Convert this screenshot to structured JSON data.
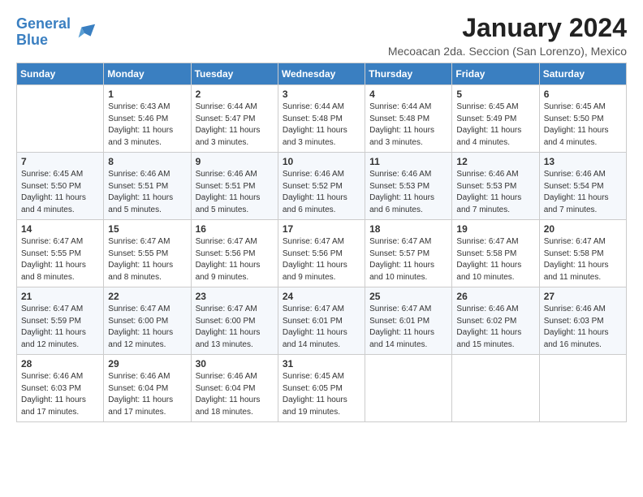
{
  "header": {
    "logo_line1": "General",
    "logo_line2": "Blue",
    "month": "January 2024",
    "location": "Mecoacan 2da. Seccion (San Lorenzo), Mexico"
  },
  "weekdays": [
    "Sunday",
    "Monday",
    "Tuesday",
    "Wednesday",
    "Thursday",
    "Friday",
    "Saturday"
  ],
  "weeks": [
    [
      {
        "day": "",
        "info": ""
      },
      {
        "day": "1",
        "info": "Sunrise: 6:43 AM\nSunset: 5:46 PM\nDaylight: 11 hours\nand 3 minutes."
      },
      {
        "day": "2",
        "info": "Sunrise: 6:44 AM\nSunset: 5:47 PM\nDaylight: 11 hours\nand 3 minutes."
      },
      {
        "day": "3",
        "info": "Sunrise: 6:44 AM\nSunset: 5:48 PM\nDaylight: 11 hours\nand 3 minutes."
      },
      {
        "day": "4",
        "info": "Sunrise: 6:44 AM\nSunset: 5:48 PM\nDaylight: 11 hours\nand 3 minutes."
      },
      {
        "day": "5",
        "info": "Sunrise: 6:45 AM\nSunset: 5:49 PM\nDaylight: 11 hours\nand 4 minutes."
      },
      {
        "day": "6",
        "info": "Sunrise: 6:45 AM\nSunset: 5:50 PM\nDaylight: 11 hours\nand 4 minutes."
      }
    ],
    [
      {
        "day": "7",
        "info": "Sunrise: 6:45 AM\nSunset: 5:50 PM\nDaylight: 11 hours\nand 4 minutes."
      },
      {
        "day": "8",
        "info": "Sunrise: 6:46 AM\nSunset: 5:51 PM\nDaylight: 11 hours\nand 5 minutes."
      },
      {
        "day": "9",
        "info": "Sunrise: 6:46 AM\nSunset: 5:51 PM\nDaylight: 11 hours\nand 5 minutes."
      },
      {
        "day": "10",
        "info": "Sunrise: 6:46 AM\nSunset: 5:52 PM\nDaylight: 11 hours\nand 6 minutes."
      },
      {
        "day": "11",
        "info": "Sunrise: 6:46 AM\nSunset: 5:53 PM\nDaylight: 11 hours\nand 6 minutes."
      },
      {
        "day": "12",
        "info": "Sunrise: 6:46 AM\nSunset: 5:53 PM\nDaylight: 11 hours\nand 7 minutes."
      },
      {
        "day": "13",
        "info": "Sunrise: 6:46 AM\nSunset: 5:54 PM\nDaylight: 11 hours\nand 7 minutes."
      }
    ],
    [
      {
        "day": "14",
        "info": "Sunrise: 6:47 AM\nSunset: 5:55 PM\nDaylight: 11 hours\nand 8 minutes."
      },
      {
        "day": "15",
        "info": "Sunrise: 6:47 AM\nSunset: 5:55 PM\nDaylight: 11 hours\nand 8 minutes."
      },
      {
        "day": "16",
        "info": "Sunrise: 6:47 AM\nSunset: 5:56 PM\nDaylight: 11 hours\nand 9 minutes."
      },
      {
        "day": "17",
        "info": "Sunrise: 6:47 AM\nSunset: 5:56 PM\nDaylight: 11 hours\nand 9 minutes."
      },
      {
        "day": "18",
        "info": "Sunrise: 6:47 AM\nSunset: 5:57 PM\nDaylight: 11 hours\nand 10 minutes."
      },
      {
        "day": "19",
        "info": "Sunrise: 6:47 AM\nSunset: 5:58 PM\nDaylight: 11 hours\nand 10 minutes."
      },
      {
        "day": "20",
        "info": "Sunrise: 6:47 AM\nSunset: 5:58 PM\nDaylight: 11 hours\nand 11 minutes."
      }
    ],
    [
      {
        "day": "21",
        "info": "Sunrise: 6:47 AM\nSunset: 5:59 PM\nDaylight: 11 hours\nand 12 minutes."
      },
      {
        "day": "22",
        "info": "Sunrise: 6:47 AM\nSunset: 6:00 PM\nDaylight: 11 hours\nand 12 minutes."
      },
      {
        "day": "23",
        "info": "Sunrise: 6:47 AM\nSunset: 6:00 PM\nDaylight: 11 hours\nand 13 minutes."
      },
      {
        "day": "24",
        "info": "Sunrise: 6:47 AM\nSunset: 6:01 PM\nDaylight: 11 hours\nand 14 minutes."
      },
      {
        "day": "25",
        "info": "Sunrise: 6:47 AM\nSunset: 6:01 PM\nDaylight: 11 hours\nand 14 minutes."
      },
      {
        "day": "26",
        "info": "Sunrise: 6:46 AM\nSunset: 6:02 PM\nDaylight: 11 hours\nand 15 minutes."
      },
      {
        "day": "27",
        "info": "Sunrise: 6:46 AM\nSunset: 6:03 PM\nDaylight: 11 hours\nand 16 minutes."
      }
    ],
    [
      {
        "day": "28",
        "info": "Sunrise: 6:46 AM\nSunset: 6:03 PM\nDaylight: 11 hours\nand 17 minutes."
      },
      {
        "day": "29",
        "info": "Sunrise: 6:46 AM\nSunset: 6:04 PM\nDaylight: 11 hours\nand 17 minutes."
      },
      {
        "day": "30",
        "info": "Sunrise: 6:46 AM\nSunset: 6:04 PM\nDaylight: 11 hours\nand 18 minutes."
      },
      {
        "day": "31",
        "info": "Sunrise: 6:45 AM\nSunset: 6:05 PM\nDaylight: 11 hours\nand 19 minutes."
      },
      {
        "day": "",
        "info": ""
      },
      {
        "day": "",
        "info": ""
      },
      {
        "day": "",
        "info": ""
      }
    ]
  ]
}
